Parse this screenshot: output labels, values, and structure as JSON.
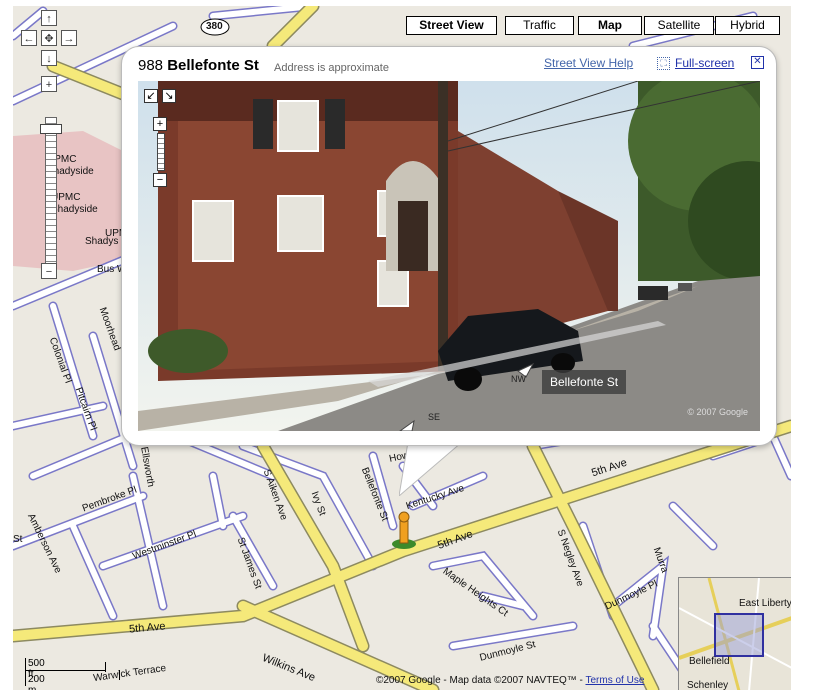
{
  "map_types": {
    "street_view": "Street View",
    "traffic": "Traffic",
    "map": "Map",
    "satellite": "Satellite",
    "hybrid": "Hybrid"
  },
  "nav": {
    "up": "↑",
    "down": "↓",
    "left": "←",
    "right": "→",
    "center": "✥",
    "zoom_in": "+",
    "zoom_out": "−"
  },
  "route_shield": "380",
  "bubble": {
    "number": "988",
    "street": "Bellefonte St",
    "subtitle": "Address is approximate",
    "help_link": "Street View Help",
    "fullscreen_link": "Full-screen",
    "fullscreen_icon": "⛶",
    "close": "✕"
  },
  "streetview": {
    "street_label": "Bellefonte St",
    "dir_nw": "NW",
    "dir_se": "SE",
    "copyright": "© 2007 Google",
    "pan_left": "↙",
    "pan_right": "↘",
    "zoom_in": "+",
    "zoom_out": "−"
  },
  "streets": {
    "upmc1": "UPMC",
    "shadyside1": "Shadyside",
    "upmc2": "UPMC",
    "shadyside2": "Shadyside",
    "upm3": "UPM",
    "shadys3": "Shadys",
    "colonial": "Colonial Pl",
    "moorhead": "Moorhead",
    "pitcairn": "Pitcairn Pl",
    "bus": "Bus W",
    "ellsworth": "Ellsworth",
    "aiken": "S Aiken Ave",
    "bellefonte": "Bellefonte St",
    "howe": "Howe St",
    "kentucky": "Kentucky Ave",
    "fifth1": "5th Ave",
    "fifth2": "5th Ave",
    "fifth3": "5th Ave",
    "pembroke": "Pembroke Pl",
    "amberson": "Amberson Ave",
    "westminster": "Westminster Pl",
    "stjames": "St James St",
    "maple": "Maple Heights Ct",
    "negley": "S Negley Ave",
    "dunmoyle1": "Dunmoyle Pl",
    "dunmoyle2": "Dunmoyle St",
    "wilkins": "Wilkins Ave",
    "warwick": "Warwick Terrace",
    "ivy": "Ivy St",
    "stn": "St",
    "murray": "Murra"
  },
  "scale": {
    "feet": "500 ft",
    "meters": "200 m"
  },
  "copyright": {
    "text": "©2007 Google - Map data ©2007 NAVTEQ™ - ",
    "terms": "Terms of Use"
  },
  "overview": {
    "east_liberty": "East Liberty",
    "bellefield": "Bellefield",
    "schenley": "Schenley"
  },
  "colors": {
    "highway": "#f5e97a",
    "road_fill": "#ffffff",
    "road_outline": "#7a78c8",
    "land": "#ece9e1",
    "hospital": "#e8c4c4",
    "link": "#2233aa"
  }
}
